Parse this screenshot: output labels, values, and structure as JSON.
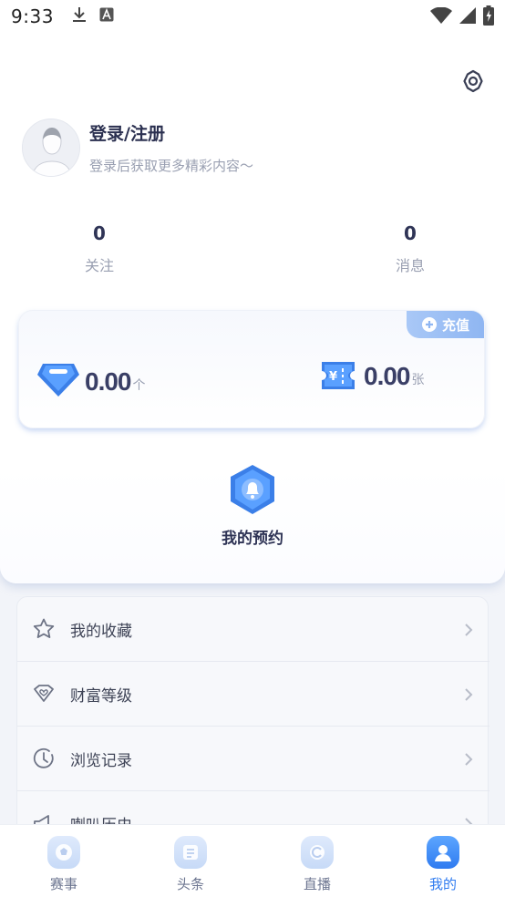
{
  "status_bar": {
    "time": "9:33",
    "icons_left": [
      "download-icon",
      "text-a-icon"
    ],
    "icons_right": [
      "wifi-icon",
      "signal-icon",
      "battery-icon"
    ]
  },
  "profile": {
    "login_title": "登录/注册",
    "login_subtitle": "登录后获取更多精彩内容～"
  },
  "stats": [
    {
      "value": "0",
      "label": "关注"
    },
    {
      "value": "0",
      "label": "消息"
    }
  ],
  "wallet": {
    "recharge_label": "充值",
    "diamonds": {
      "value": "0.00",
      "unit": "个",
      "icon": "diamond-icon"
    },
    "tickets": {
      "value": "0.00",
      "unit": "张",
      "icon": "ticket-icon"
    }
  },
  "reservation": {
    "label": "我的预约",
    "icon": "bell-icon"
  },
  "menu": [
    {
      "label": "我的收藏",
      "icon": "star-icon"
    },
    {
      "label": "财富等级",
      "icon": "heart-badge-icon"
    },
    {
      "label": "浏览记录",
      "icon": "clock-icon"
    },
    {
      "label": "喇叭历史",
      "icon": "megaphone-icon"
    }
  ],
  "tabs": [
    {
      "label": "赛事",
      "icon": "soccer-icon",
      "active": false
    },
    {
      "label": "头条",
      "icon": "news-icon",
      "active": false
    },
    {
      "label": "直播",
      "icon": "live-icon",
      "active": false
    },
    {
      "label": "我的",
      "icon": "user-icon",
      "active": true
    }
  ],
  "colors": {
    "accent": "#2f7bf0",
    "title": "#2f3456",
    "muted": "#9aa0b2",
    "recharge": "#8fb6f2"
  }
}
